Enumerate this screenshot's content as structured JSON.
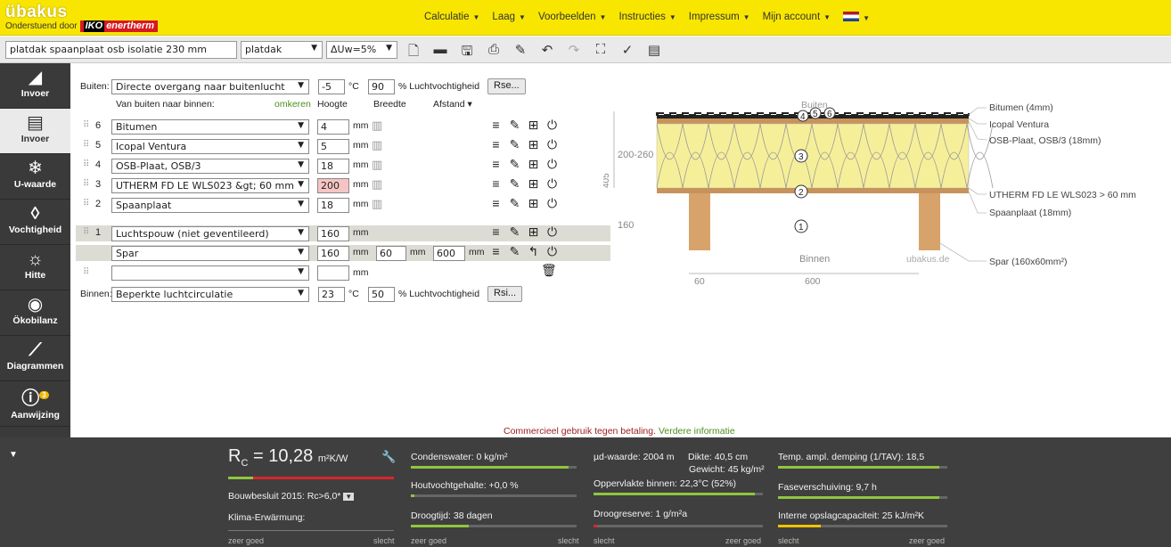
{
  "brand": {
    "name": "übakus",
    "supported_by": "Onderstuend door",
    "partner_iko": "IKO",
    "partner_name": "enertherm"
  },
  "nav": [
    {
      "label": "Calculatie"
    },
    {
      "label": "Laag"
    },
    {
      "label": "Voorbeelden"
    },
    {
      "label": "Instructies"
    },
    {
      "label": "Impressum"
    },
    {
      "label": "Mijn account"
    }
  ],
  "toolbar": {
    "project_name": "platdak spaanplaat osb isolatie 230 mm",
    "type": "platdak",
    "delta": "ΔUw=5%"
  },
  "sidebar": [
    {
      "label": "Invoer"
    },
    {
      "label": "Invoer",
      "active": true
    },
    {
      "label": "U-waarde"
    },
    {
      "label": "Vochtigheid"
    },
    {
      "label": "Hitte"
    },
    {
      "label": "Ökobilanz"
    },
    {
      "label": "Diagrammen"
    },
    {
      "label": "Aanwijzing",
      "badge": "3"
    }
  ],
  "outside": {
    "label": "Buiten:",
    "condition": "Directe overgang naar buitenlucht",
    "temp": "-5",
    "temp_unit": "°C",
    "humidity": "90",
    "humidity_label": "% Luchtvochtigheid",
    "button": "Rse..."
  },
  "headers": {
    "direction": "Van buiten naar binnen:",
    "reverse": "omkeren",
    "height": "Hoogte",
    "width": "Breedte",
    "distance": "Afstand"
  },
  "layers": [
    {
      "no": "6",
      "name": "Bitumen",
      "height": "4",
      "unit": "mm"
    },
    {
      "no": "5",
      "name": "Icopal Ventura",
      "height": "5",
      "unit": "mm"
    },
    {
      "no": "4",
      "name": "OSB-Plaat, OSB/3",
      "height": "18",
      "unit": "mm"
    },
    {
      "no": "3",
      "name": "UTHERM FD LE WLS023 &gt; 60 mm",
      "height": "200",
      "unit": "mm",
      "warn": true
    },
    {
      "no": "2",
      "name": "Spaanplaat",
      "height": "18",
      "unit": "mm"
    },
    {
      "no": "1",
      "name": "Luchtspouw (niet geventileerd)",
      "height": "160",
      "unit": "mm"
    }
  ],
  "sublayer": {
    "name": "Spar",
    "height": "160",
    "width": "60",
    "distance": "600",
    "unit": "mm"
  },
  "empty_row": {
    "unit": "mm"
  },
  "inside": {
    "label": "Binnen:",
    "condition": "Beperkte luchtcirculatie",
    "temp": "23",
    "temp_unit": "°C",
    "humidity": "50",
    "humidity_label": "% Luchtvochtigheid",
    "button": "Rsi..."
  },
  "diagram": {
    "outside_label": "Buiten",
    "inside_label": "Binnen",
    "watermark": "ubakus.de",
    "dims": {
      "left_top": "200-260",
      "left_total": "405",
      "left_bottom": "160",
      "spar_width": "60",
      "spacing": "600"
    },
    "legend": [
      "Bitumen (4mm)",
      "Icopal Ventura",
      "OSB-Plaat, OSB/3 (18mm)",
      "UTHERM FD LE WLS023 > 60 mm",
      "Spaanplaat (18mm)",
      "Spar (160x60mm²)"
    ],
    "markers": [
      "4",
      "5",
      "6",
      "3",
      "2",
      "1"
    ]
  },
  "notice": {
    "text": "Commercieel gebruik tegen betaling.",
    "link": "Verdere informatie"
  },
  "results": {
    "rc_label": "R",
    "rc_sub": "C",
    "rc_value": "= 10,28",
    "rc_unit": "m²K/W",
    "bouwbesluit": "Bouwbesluit 2015: Rc>6,0*",
    "klima": "Klima-Erwärmung:",
    "condens": "Condenswater: 0 kg/m²",
    "hout": "Houtvochtgehalte: +0,0 %",
    "droogtijd": "Droogtijd: 38 dagen",
    "ud": "µd-waarde: 2004 m",
    "dikte": "Dikte: 40,5 cm",
    "gewicht": "Gewicht: 45 kg/m²",
    "oppervlakte": "Oppervlakte binnen: 22,3°C (52%)",
    "droogreserve": "Droogreserve: 1 g/m²a",
    "temp_ampl": "Temp. ampl. demping (1/TAV): 18,5",
    "fase": "Faseverschuiving: 9,7 h",
    "opslag": "Interne opslagcapaciteit: 25 kJ/m²K",
    "scale_good": "zeer goed",
    "scale_bad": "slecht"
  },
  "colors": {
    "topbar": "#f9e600",
    "sidebar": "#3a3a3a",
    "bottom": "#3f3f3f",
    "good": "#8fc63f",
    "bad": "#d9262c",
    "insulation": "#f6ef9a",
    "wood": "#d7a36b"
  },
  "progress": {
    "rc": 0.15,
    "condens": 0.95,
    "hout": 0.02,
    "droogtijd": 0.35,
    "oppervlakte": 0.95,
    "droogreserve": 0.02,
    "temp_ampl": 0.95,
    "fase": 0.95,
    "opslag": 0.25
  }
}
